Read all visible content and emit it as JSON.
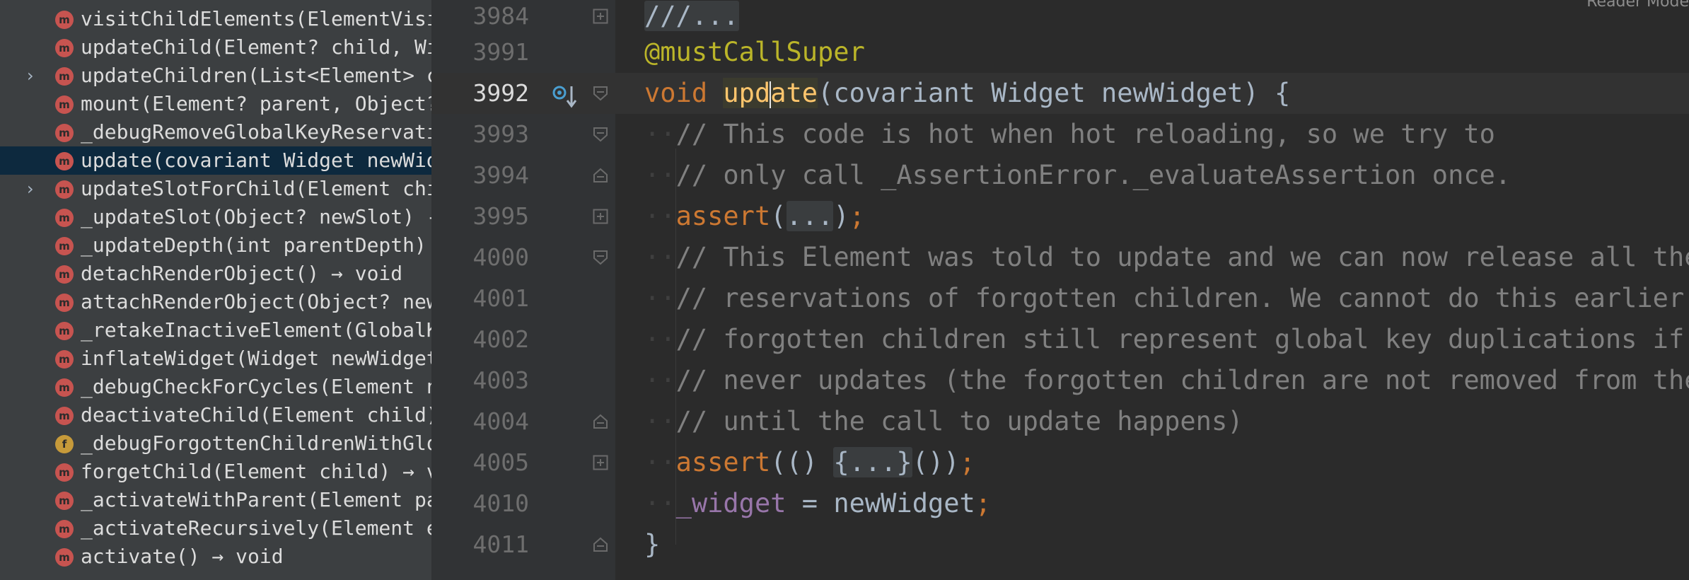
{
  "structure": {
    "items": [
      {
        "label": "visitChildElements(ElementVisi",
        "kind": "method",
        "badge": "m",
        "expandable": false,
        "selected": false
      },
      {
        "label": "updateChild(Element? child, Wi",
        "kind": "method",
        "badge": "m",
        "expandable": false,
        "selected": false
      },
      {
        "label": "updateChildren(List<Element> c",
        "kind": "method",
        "badge": "m",
        "expandable": true,
        "selected": false
      },
      {
        "label": "mount(Element? parent, Object?",
        "kind": "method",
        "badge": "m",
        "expandable": false,
        "selected": false
      },
      {
        "label": "_debugRemoveGlobalKeyReservati",
        "kind": "method",
        "badge": "m",
        "expandable": false,
        "selected": false
      },
      {
        "label": "update(covariant Widget newWid",
        "kind": "method",
        "badge": "m",
        "expandable": false,
        "selected": true
      },
      {
        "label": "updateSlotForChild(Element chi",
        "kind": "method",
        "badge": "m",
        "expandable": true,
        "selected": false
      },
      {
        "label": "_updateSlot(Object? newSlot) -",
        "kind": "method",
        "badge": "m",
        "expandable": false,
        "selected": false
      },
      {
        "label": "_updateDepth(int parentDepth) ",
        "kind": "method",
        "badge": "m",
        "expandable": false,
        "selected": false
      },
      {
        "label": "detachRenderObject() → void",
        "kind": "method",
        "badge": "m",
        "expandable": false,
        "selected": false
      },
      {
        "label": "attachRenderObject(Object? new",
        "kind": "method",
        "badge": "m",
        "expandable": false,
        "selected": false
      },
      {
        "label": "_retakeInactiveElement(GlobalK",
        "kind": "method",
        "badge": "m",
        "expandable": false,
        "selected": false
      },
      {
        "label": "inflateWidget(Widget newWidget",
        "kind": "method",
        "badge": "m",
        "expandable": false,
        "selected": false
      },
      {
        "label": "_debugCheckForCycles(Element n",
        "kind": "method",
        "badge": "m",
        "expandable": false,
        "selected": false
      },
      {
        "label": "deactivateChild(Element child)",
        "kind": "method",
        "badge": "m",
        "expandable": false,
        "selected": false
      },
      {
        "label": "_debugForgottenChildrenWithGlo",
        "kind": "field",
        "badge": "f",
        "expandable": false,
        "selected": false
      },
      {
        "label": "forgetChild(Element child) → v",
        "kind": "method",
        "badge": "m",
        "expandable": false,
        "selected": false
      },
      {
        "label": "_activateWithParent(Element pa",
        "kind": "method",
        "badge": "m",
        "expandable": false,
        "selected": false
      },
      {
        "label": "_activateRecursively(Element e",
        "kind": "method",
        "badge": "m",
        "expandable": false,
        "selected": false
      },
      {
        "label": "activate() → void",
        "kind": "method",
        "badge": "m",
        "expandable": false,
        "selected": false
      }
    ],
    "expand_icon": "chevron-right-icon"
  },
  "editor": {
    "reader_mode_label": "Reader Mode",
    "current_line": "3992",
    "lines": [
      {
        "num": "3984",
        "fold": "collapsed"
      },
      {
        "num": "3991",
        "fold": "none"
      },
      {
        "num": "3992",
        "fold": "open",
        "override_marker": true
      },
      {
        "num": "3993",
        "fold": "open"
      },
      {
        "num": "3994",
        "fold": "close"
      },
      {
        "num": "3995",
        "fold": "collapsed"
      },
      {
        "num": "4000",
        "fold": "open"
      },
      {
        "num": "4001",
        "fold": "none"
      },
      {
        "num": "4002",
        "fold": "none"
      },
      {
        "num": "4003",
        "fold": "none"
      },
      {
        "num": "4004",
        "fold": "close"
      },
      {
        "num": "4005",
        "fold": "collapsed"
      },
      {
        "num": "4010",
        "fold": "none"
      },
      {
        "num": "4011",
        "fold": "close"
      }
    ],
    "code": {
      "l3984_fold": "///...",
      "l3991_annotation": "@mustCallSuper",
      "l3992_kw": "void",
      "l3992_name_a": "upd",
      "l3992_name_b": "ate",
      "l3992_rest": "(covariant Widget newWidget) {",
      "l3993": "// This code is hot when hot reloading, so we try to",
      "l3994": "// only call _AssertionError._evaluateAssertion once.",
      "l3995_kw": "assert",
      "l3995_open": "(",
      "l3995_fold": "...",
      "l3995_close": ")",
      "semicolon": ";",
      "l4000": "// This Element was told to update and we can now release all the",
      "l4001": "// reservations of forgotten children. We cannot do this earlier",
      "l4002": "// forgotten children still represent global key duplications if",
      "l4003": "// never updates (the forgotten children are not removed from the",
      "l4004": "// until the call to update happens)",
      "l4005_kw": "assert",
      "l4005_open": "(() ",
      "l4005_fold": "{...}",
      "l4005_close": "())",
      "l4010_field": "_widget",
      "l4010_rest": " = newWidget",
      "l4011": "}"
    }
  },
  "colors": {
    "background": "#2b2b2b",
    "panel": "#3c3f41",
    "selection": "#0d293e",
    "keyword": "#cc7832",
    "annotation": "#bbb529",
    "comment": "#808080",
    "field": "#9876aa",
    "function_highlight": "#ffc66d",
    "method_badge": "#c75450",
    "field_badge": "#c69a3a"
  }
}
